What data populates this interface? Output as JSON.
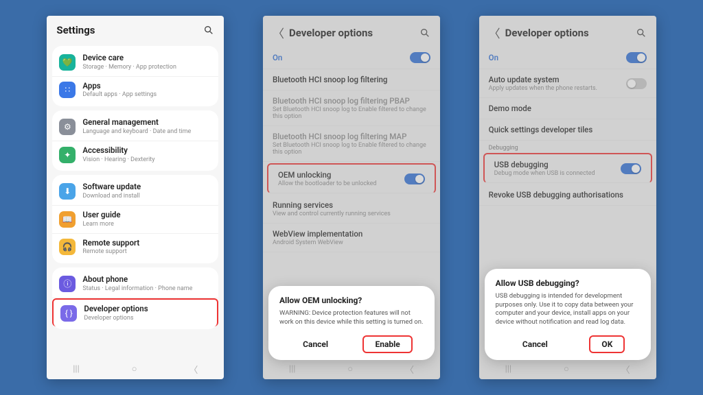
{
  "colors": {
    "teal": "#18b39b",
    "blue": "#3b78e7",
    "grey": "#8a8f99",
    "green": "#34b06a",
    "lightblue": "#4aa4e8",
    "orange": "#f0a030",
    "yellow": "#f4b83a",
    "purple": "#6b5be0",
    "indigo": "#7a6ae8"
  },
  "screen1": {
    "title": "Settings",
    "groups": [
      [
        {
          "icon": "💚",
          "bg": "teal",
          "title": "Device care",
          "sub": "Storage  ·  Memory  ·  App protection"
        },
        {
          "icon": "∷",
          "bg": "blue",
          "title": "Apps",
          "sub": "Default apps  ·  App settings"
        }
      ],
      [
        {
          "icon": "⚙",
          "bg": "grey",
          "title": "General management",
          "sub": "Language and keyboard  ·  Date and time"
        },
        {
          "icon": "✦",
          "bg": "green",
          "title": "Accessibility",
          "sub": "Vision  ·  Hearing  ·  Dexterity"
        }
      ],
      [
        {
          "icon": "⬇",
          "bg": "lightblue",
          "title": "Software update",
          "sub": "Download and install"
        },
        {
          "icon": "📖",
          "bg": "orange",
          "title": "User guide",
          "sub": "Learn more"
        },
        {
          "icon": "🎧",
          "bg": "yellow",
          "title": "Remote support",
          "sub": "Remote support"
        }
      ],
      [
        {
          "icon": "ⓘ",
          "bg": "purple",
          "title": "About phone",
          "sub": "Status  ·  Legal information  ·  Phone name"
        },
        {
          "icon": "{ }",
          "bg": "indigo",
          "title": "Developer options",
          "sub": "Developer options",
          "highlight": true
        }
      ]
    ]
  },
  "screen2": {
    "title": "Developer options",
    "on_label": "On",
    "rows": [
      {
        "title": "Bluetooth HCI snoop log filtering",
        "cropped": true
      },
      {
        "title": "Bluetooth HCI snoop log filtering PBAP",
        "sub": "Set Bluetooth HCI snoop log to Enable filtered to change this option",
        "dim": true
      },
      {
        "title": "Bluetooth HCI snoop log filtering MAP",
        "sub": "Set Bluetooth HCI snoop log to Enable filtered to change this option",
        "dim": true
      },
      {
        "title": "OEM unlocking",
        "sub": "Allow the bootloader to be unlocked",
        "toggle": true,
        "on": true,
        "highlight": true
      },
      {
        "title": "Running services",
        "sub": "View and control currently running services"
      },
      {
        "title": "WebView implementation",
        "sub": "Android System WebView"
      }
    ],
    "dialog": {
      "title": "Allow OEM unlocking?",
      "body": "WARNING: Device protection features will not work on this device while this setting is turned on.",
      "cancel": "Cancel",
      "confirm": "Enable"
    }
  },
  "screen3": {
    "title": "Developer options",
    "on_label": "On",
    "rows": [
      {
        "title": "Auto update system",
        "sub": "Apply updates when the phone restarts.",
        "toggle": true,
        "on": false
      },
      {
        "title": "Demo mode"
      },
      {
        "title": "Quick settings developer tiles"
      }
    ],
    "section": "Debugging",
    "rows2": [
      {
        "title": "USB debugging",
        "sub": "Debug mode when USB is connected",
        "toggle": true,
        "on": true,
        "highlight": true
      },
      {
        "title": "Revoke USB debugging authorisations"
      }
    ],
    "dialog": {
      "title": "Allow USB debugging?",
      "body": "USB debugging is intended for development purposes only. Use it to copy data between your computer and your device, install apps on your device without notification and read log data.",
      "cancel": "Cancel",
      "confirm": "OK"
    }
  }
}
